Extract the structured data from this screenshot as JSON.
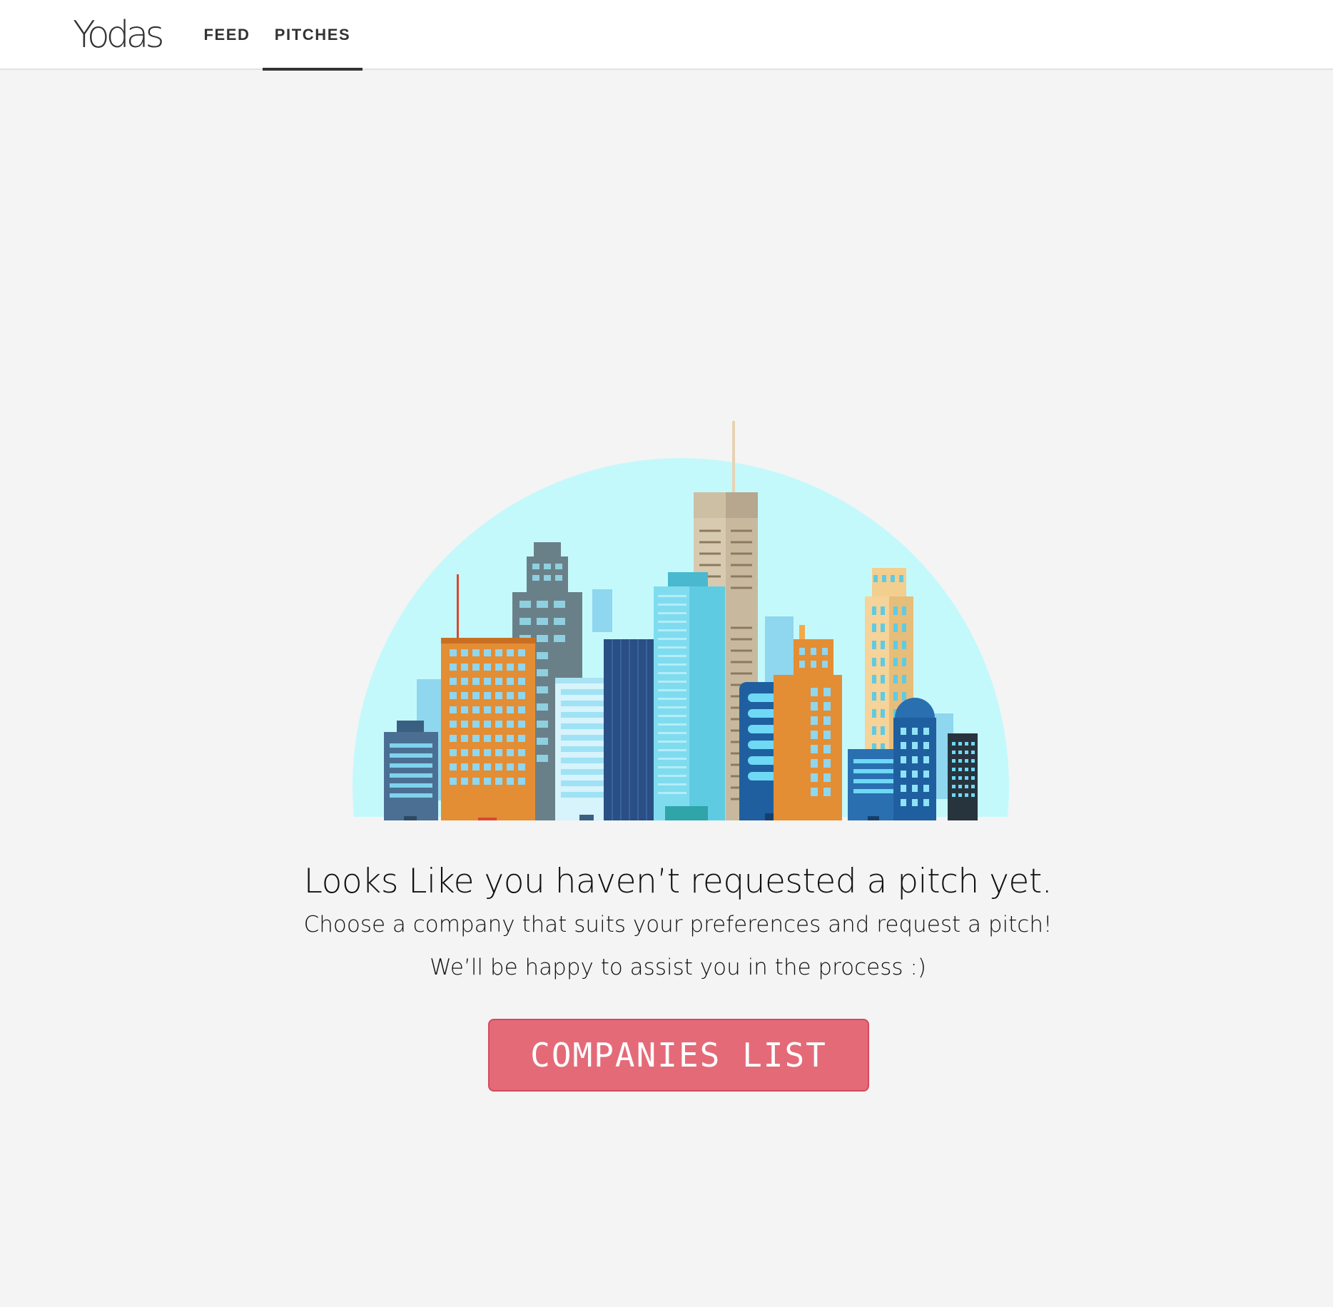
{
  "header": {
    "logo_text": "Yodas",
    "tabs": [
      {
        "label": "FEED",
        "active": false
      },
      {
        "label": "PITCHES",
        "active": true
      }
    ]
  },
  "empty_state": {
    "illustration_icon": "city-skyline-illustration",
    "headline": "Looks Like you haven’t requested a pitch yet.",
    "line1": "Choose a company that suits your preferences and request a pitch!",
    "line2": "We’ll be happy to assist you in the process :)",
    "cta_label": "COMPANIES LIST"
  },
  "colors": {
    "background": "#f4f4f4",
    "header_bg": "#ffffff",
    "cta": "#e46a78",
    "sky_circle": "#c4f9fc"
  }
}
